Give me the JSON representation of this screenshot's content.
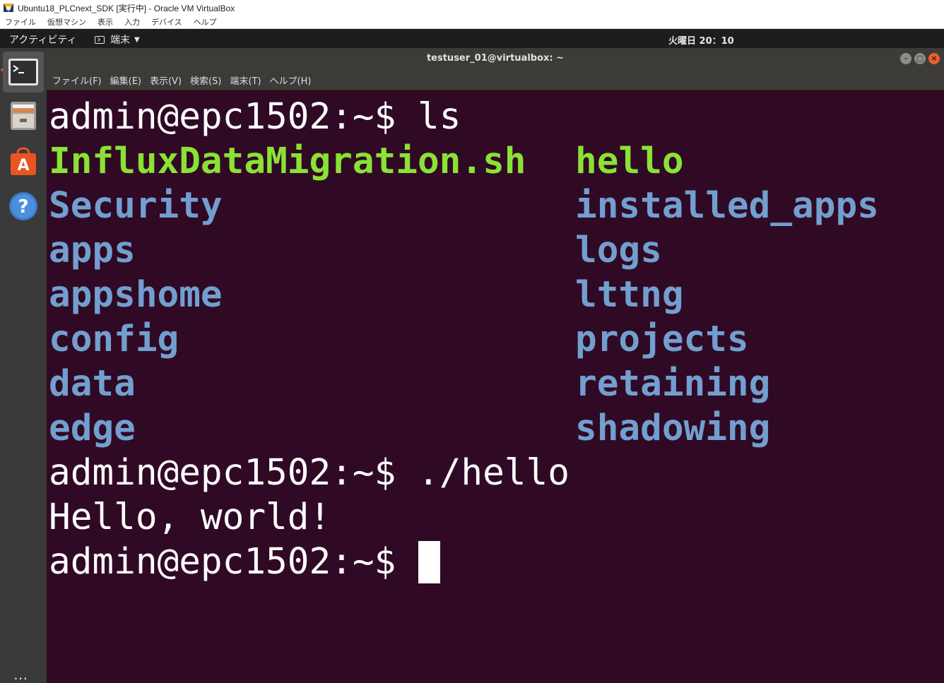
{
  "vbox": {
    "title": "Ubuntu18_PLCnext_SDK [実行中] - Oracle VM VirtualBox",
    "menu": [
      "ファイル",
      "仮想マシン",
      "表示",
      "入力",
      "デバイス",
      "ヘルプ"
    ]
  },
  "topbar": {
    "activities": "アクティビティ",
    "app_menu": "端末",
    "clock": "火曜日 20：10"
  },
  "dock": {
    "items": [
      "terminal-icon",
      "files-icon",
      "software-icon",
      "help-icon"
    ],
    "show_apps": "⋯"
  },
  "terminal": {
    "window_title": "testuser_01@virtualbox: ~",
    "menu": [
      "ファイル(F)",
      "編集(E)",
      "表示(V)",
      "検索(S)",
      "端末(T)",
      "ヘルプ(H)"
    ],
    "prompt": "admin@epc1502:~$ ",
    "cmd1": "ls",
    "ls_rows": [
      {
        "left": "InfluxDataMigration.sh",
        "right": "hello"
      },
      {
        "left": "Security",
        "right": "installed_apps"
      },
      {
        "left": "apps",
        "right": "logs"
      },
      {
        "left": "appshome",
        "right": "lttng"
      },
      {
        "left": "config",
        "right": "projects"
      },
      {
        "left": "data",
        "right": "retaining"
      },
      {
        "left": "edge",
        "right": "shadowing"
      }
    ],
    "cmd2": "./hello",
    "output": "Hello, world!",
    "colors": {
      "background": "#300a24",
      "executable": "#8ae234",
      "directory": "#729fcf"
    }
  }
}
